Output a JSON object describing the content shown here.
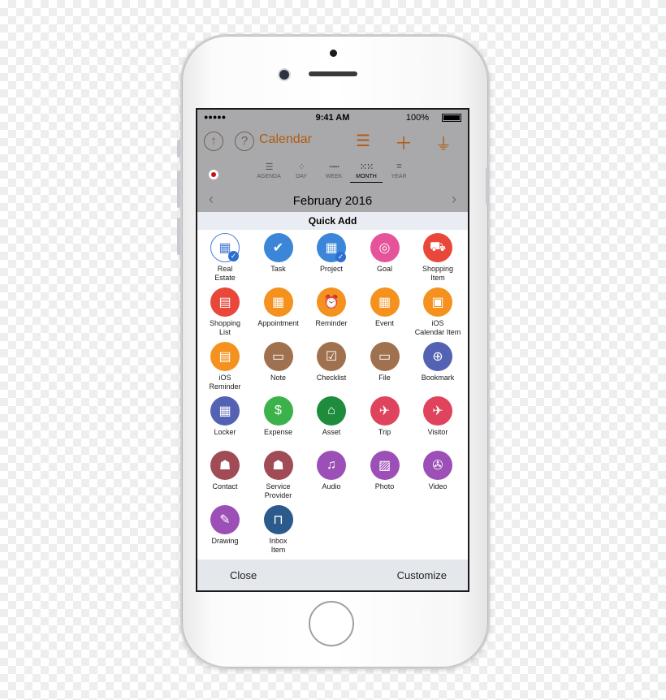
{
  "status_bar": {
    "signal": "●●●●● ",
    "wifi": "wifi-icon",
    "time": "9:41 AM",
    "battery": "100%"
  },
  "nav": {
    "title": "Calendar",
    "help": "?",
    "up": "↑"
  },
  "views": [
    {
      "label": "AGENDA",
      "glyph": "☰"
    },
    {
      "label": "DAY",
      "glyph": "⁘"
    },
    {
      "label": "WEEK",
      "glyph": "┅┅"
    },
    {
      "label": "MONTH",
      "glyph": "⁙⁙"
    },
    {
      "label": "YEAR",
      "glyph": "≡"
    }
  ],
  "selected_view": "MONTH",
  "month": {
    "title": "February 2016",
    "prev": "‹",
    "next": "›"
  },
  "quick_add": {
    "title": "Quick Add",
    "items": [
      {
        "label": "Real\nEstate",
        "color": "#ffffff",
        "glyph": "▦"
      },
      {
        "label": "Task",
        "color": "#3b86d8",
        "glyph": "✔"
      },
      {
        "label": "Project",
        "color": "#3b86d8",
        "glyph": "▦"
      },
      {
        "label": "Goal",
        "color": "#e5549a",
        "glyph": "◎"
      },
      {
        "label": "Shopping\nItem",
        "color": "#e8473a",
        "glyph": "⛟"
      },
      {
        "label": "Shopping\nList",
        "color": "#e8473a",
        "glyph": "▤"
      },
      {
        "label": "Appointment",
        "color": "#f5911e",
        "glyph": "▦"
      },
      {
        "label": "Reminder",
        "color": "#f5911e",
        "glyph": "⏰"
      },
      {
        "label": "Event",
        "color": "#f5911e",
        "glyph": "▦"
      },
      {
        "label": "iOS\nCalendar Item",
        "color": "#f5911e",
        "glyph": "▣"
      },
      {
        "label": "iOS\nReminder",
        "color": "#f5911e",
        "glyph": "▤"
      },
      {
        "label": "Note",
        "color": "#a0714f",
        "glyph": "▭"
      },
      {
        "label": "Checklist",
        "color": "#a0714f",
        "glyph": "☑"
      },
      {
        "label": "File",
        "color": "#a0714f",
        "glyph": "▭"
      },
      {
        "label": "Bookmark",
        "color": "#5362b3",
        "glyph": "⊕"
      },
      {
        "label": "Locker",
        "color": "#5362b3",
        "glyph": "▦"
      },
      {
        "label": "Expense",
        "color": "#3cb34a",
        "glyph": "$"
      },
      {
        "label": "Asset",
        "color": "#1e8c3c",
        "glyph": "⌂"
      },
      {
        "label": "Trip",
        "color": "#e0435d",
        "glyph": "✈"
      },
      {
        "label": "Visitor",
        "color": "#e0435d",
        "glyph": "✈"
      },
      {
        "label": "Contact",
        "color": "#a04b55",
        "glyph": "☗"
      },
      {
        "label": "Service\nProvider",
        "color": "#a04b55",
        "glyph": "☗"
      },
      {
        "label": "Audio",
        "color": "#9c4fb7",
        "glyph": "♫"
      },
      {
        "label": "Photo",
        "color": "#9c4fb7",
        "glyph": "▨"
      },
      {
        "label": "Video",
        "color": "#9c4fb7",
        "glyph": "✇"
      },
      {
        "label": "Drawing",
        "color": "#9c4fb7",
        "glyph": "✎"
      },
      {
        "label": "Inbox\nItem",
        "color": "#2b5a8c",
        "glyph": "⊓"
      }
    ]
  },
  "footer": {
    "close": "Close",
    "customize": "Customize"
  }
}
